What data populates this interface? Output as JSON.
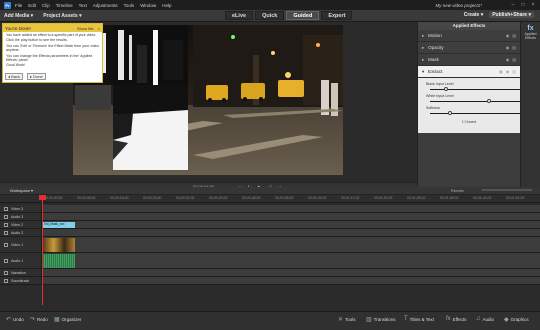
{
  "menubar": {
    "items": [
      "File",
      "Edit",
      "Clip",
      "Timeline",
      "Text",
      "Adjustments",
      "Tools",
      "Window",
      "Help"
    ],
    "project": "My new video project1*",
    "window_controls": [
      "minimize-icon",
      "maximize-icon",
      "close-icon"
    ]
  },
  "toolbar": {
    "add_media": "Add Media",
    "project_assets": "Project Assets",
    "modes": [
      "eLive",
      "Quick",
      "Guided",
      "Expert"
    ],
    "active_mode": "Guided",
    "create": "Create",
    "publish": "Publish+Share"
  },
  "tooltip": {
    "title": "You're Done!",
    "show_me": "Show Me",
    "lines": [
      "You have added an effect to a specific part of your video.",
      "Click the play button to see the results.",
      "You can 'Edit' or 'Remove' the Effect Mask from your video anytime.",
      "You can change the Effects parameters in the 'Applied Effects' panel.",
      "Good Work!"
    ],
    "back": "Back",
    "done": "Done"
  },
  "monitor": {
    "timecode": "00;00;04;06",
    "render": "Render"
  },
  "panel": {
    "title": "Applied Effects",
    "effects": [
      "Motion",
      "Opacity",
      "Mask"
    ],
    "extract": {
      "name": "Extract",
      "params": [
        {
          "label": "Black Input Level",
          "value": 0.28
        },
        {
          "label": "White Input Level",
          "value": 0.78
        },
        {
          "label": "Softness",
          "value": 0.33
        }
      ],
      "invert": "Invert"
    }
  },
  "sidebar": {
    "items": [
      "Applied Effects"
    ]
  },
  "timeline": {
    "workspace": "Workspace",
    "render": "Render",
    "ruler": [
      "00;00;00;00",
      "00;00;08;00",
      "00;00;16;00",
      "00;00;24;00",
      "00;00;32;00",
      "00;00;40;00",
      "00;00;48;00",
      "00;00;56;00",
      "00;01;04;02",
      "00;01;12;02",
      "00;01;20;02",
      "00;01;28;02",
      "00;01;36;02",
      "00;01;44;02",
      "00;01;52;02"
    ],
    "tracks": [
      "Video 3",
      "Audio 3",
      "Video 2",
      "Audio 2",
      "Video 1",
      "Audio 1",
      "Narration",
      "Soundtrack"
    ],
    "clips": {
      "v2": "Vid_Mask_xxx",
      "v1": "Vid_Mask_xxx"
    }
  },
  "bottom": {
    "left": [
      "Undo",
      "Redo",
      "Organizer"
    ],
    "right": [
      "Tools",
      "Transitions",
      "Titles & Text",
      "Effects",
      "Audio",
      "Graphics"
    ]
  },
  "colors": {
    "accent": "#e8c640",
    "playhead": "#e23030",
    "clip_video": "#7fd0e6",
    "panel_bg": "#3c3c3c"
  }
}
